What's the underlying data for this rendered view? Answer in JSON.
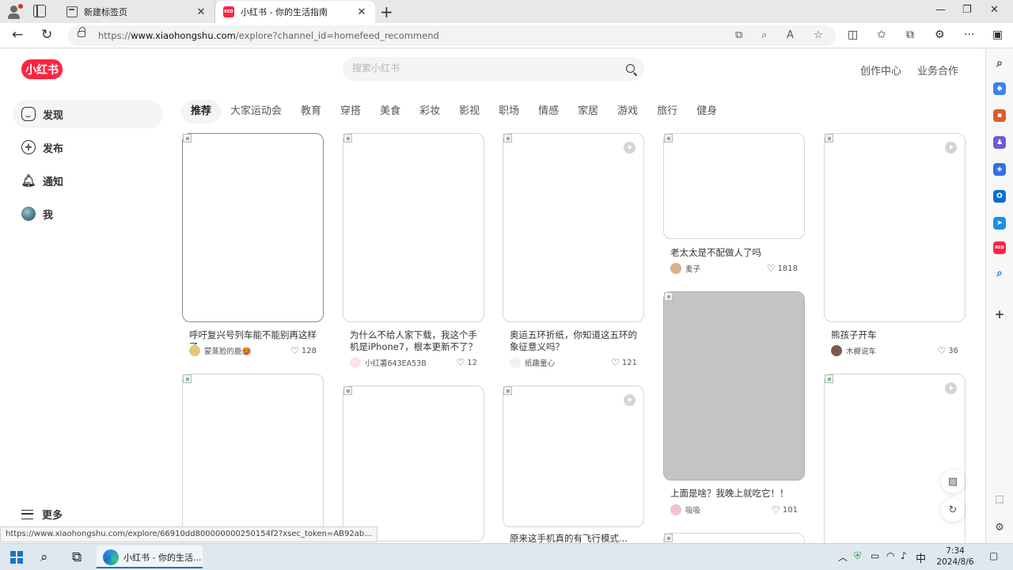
{
  "browser": {
    "tabs": [
      {
        "label": "新建标签页"
      },
      {
        "label": "小红书 - 你的生活指南"
      }
    ],
    "tab_close_glyph": "✕",
    "new_tab_glyph": "+",
    "url": {
      "prefix": "https://",
      "host": "www.xiaohongshu.com",
      "path": "/explore?channel_id=homefeed_recommend"
    },
    "status_url": "https://www.xiaohongshu.com/explore/66910dd800000000250154f2?xsec_token=AB92ab..."
  },
  "page": {
    "logo_text": "小红书",
    "search_placeholder": "搜索小红书",
    "top_links": [
      "创作中心",
      "业务合作"
    ],
    "sidebar": [
      "发现",
      "发布",
      "通知",
      "我"
    ],
    "sidebar_more": "更多",
    "channels": [
      "推荐",
      "大家运动会",
      "教育",
      "穿搭",
      "美食",
      "彩妆",
      "影视",
      "职场",
      "情感",
      "家居",
      "游戏",
      "旅行",
      "健身"
    ],
    "active_channel": "推荐",
    "cards": [
      {
        "title": "呼吁复兴号列车能不能别再这样了",
        "author": "蒙蒸脸的鹿🥵",
        "likes": "128"
      },
      {
        "title": "为什么不给人家下载，我这个手机是iPhone7，根本更新不了？怎...",
        "author": "小红薯643EA53B",
        "likes": "12"
      },
      {
        "title": "奥运五环折纸，你知道这五环的象征意义吗？",
        "author": "纸趣童心",
        "likes": "121",
        "video": true
      },
      {
        "title": "老太太是不配做人了吗",
        "author": "麦子",
        "likes": "1818"
      },
      {
        "title": "熊孩子开车",
        "author": "木樨说车",
        "likes": "36",
        "video": true
      },
      {
        "title": "上面是啥？我晚上就吃它！！",
        "author": "吸吸",
        "likes": "101"
      },
      {
        "title": "原来这手机真的有飞行模式...",
        "author": "",
        "likes": ""
      }
    ]
  },
  "taskbar": {
    "app_label": "小红书 - 你的生活...",
    "ime": "中",
    "time": "7:34",
    "date": "2024/8/6"
  },
  "colors": {
    "brand": "#ff2442",
    "placeholder_gray": "#c0c0c0",
    "accent_blue": "#1a73c9"
  },
  "icons": [
    "profile-icon",
    "tab-actions-icon",
    "new-tab-icon",
    "back-icon",
    "refresh-icon",
    "lock-icon",
    "open-app-icon",
    "zoom-icon",
    "read-aloud-icon",
    "favorite-star-icon",
    "split-screen-icon",
    "favorites-icon",
    "collections-icon",
    "extensions-icon",
    "more-icon",
    "home-icon",
    "plus-icon",
    "bell-icon",
    "menu-icon",
    "heart-icon",
    "play-icon",
    "image-icon",
    "refresh-feed-icon"
  ]
}
